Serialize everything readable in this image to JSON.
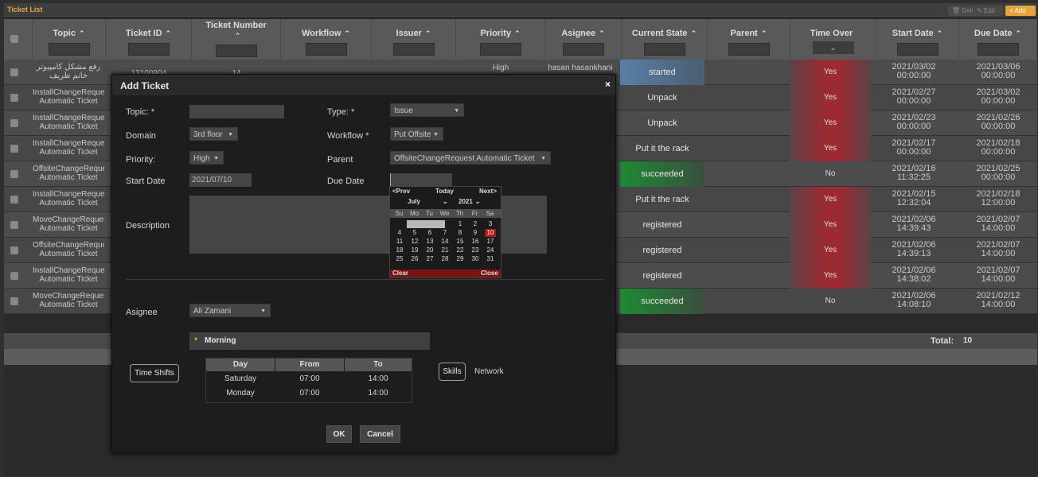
{
  "titlebar": {
    "title": "Ticket List",
    "delete": "🗑 Delete",
    "edit": "✎ Edit",
    "add": "+ Add"
  },
  "columns": [
    {
      "label": "Topic",
      "sort": "⌃"
    },
    {
      "label": "Ticket ID",
      "sort": "⌃"
    },
    {
      "label": "Ticket Number",
      "sort": "⌃"
    },
    {
      "label": "Workflow",
      "sort": "⌃"
    },
    {
      "label": "Issuer",
      "sort": "⌃"
    },
    {
      "label": "Priority",
      "sort": "⌃"
    },
    {
      "label": "Asignee",
      "sort": "⌃"
    },
    {
      "label": "Current State",
      "sort": "⌃"
    },
    {
      "label": "Parent",
      "sort": "⌃"
    },
    {
      "label": "Time Over",
      "sort": ""
    },
    {
      "label": "Start Date",
      "sort": "⌃"
    },
    {
      "label": "Due Date",
      "sort": "⌃"
    }
  ],
  "time_over_filter": "⌄",
  "rows": [
    {
      "topic1": "رفع مشکل کامپیوتر",
      "topic2": "خانم ظریف",
      "id": "13100904",
      "number": "14",
      "priority": "High",
      "asignee": "hasan hasankhani",
      "state": "started",
      "time_over": "Yes",
      "start1": "2021/03/02",
      "start2": "00:00:00",
      "due1": "2021/03/06",
      "due2": "00:00:00"
    },
    {
      "topic1": "InstallChangeReque",
      "topic2": "Automatic Ticket",
      "state": "Unpack",
      "time_over": "Yes",
      "start1": "2021/02/27",
      "start2": "00:00:00",
      "due1": "2021/03/02",
      "due2": "00:00:00"
    },
    {
      "topic1": "InstallChangeReque",
      "topic2": "Automatic Ticket",
      "state": "Unpack",
      "time_over": "Yes",
      "start1": "2021/02/23",
      "start2": "00:00:00",
      "due1": "2021/02/26",
      "due2": "00:00:00"
    },
    {
      "topic1": "InstallChangeReque",
      "topic2": "Automatic Ticket",
      "state": "Put it the rack",
      "time_over": "Yes",
      "start1": "2021/02/17",
      "start2": "00:00:00",
      "due1": "2021/02/18",
      "due2": "00:00:00"
    },
    {
      "topic1": "OffsiteChangeReque",
      "topic2": "Automatic Ticket",
      "state": "succeeded",
      "time_over": "No",
      "start1": "2021/02/16",
      "start2": "11:32:25",
      "due1": "2021/02/25",
      "due2": "00:00:00"
    },
    {
      "topic1": "InstallChangeReque",
      "topic2": "Automatic Ticket",
      "state": "Put it the rack",
      "time_over": "Yes",
      "start1": "2021/02/15",
      "start2": "12:32:04",
      "due1": "2021/02/18",
      "due2": "12:00:00"
    },
    {
      "topic1": "MoveChangeReques",
      "topic2": "Automatic Ticket",
      "state": "registered",
      "time_over": "Yes",
      "start1": "2021/02/06",
      "start2": "14:39:43",
      "due1": "2021/02/07",
      "due2": "14:00:00"
    },
    {
      "topic1": "OffsiteChangeReque",
      "topic2": "Automatic Ticket",
      "state": "registered",
      "time_over": "Yes",
      "start1": "2021/02/06",
      "start2": "14:39:13",
      "due1": "2021/02/07",
      "due2": "14:00:00"
    },
    {
      "topic1": "InstallChangeReque",
      "topic2": "Automatic Ticket",
      "state": "registered",
      "time_over": "Yes",
      "start1": "2021/02/06",
      "start2": "14:38:02",
      "due1": "2021/02/07",
      "due2": "14:00:00"
    },
    {
      "topic1": "MoveChangeReques",
      "topic2": "Automatic Ticket",
      "state": "succeeded",
      "time_over": "No",
      "start1": "2021/02/06",
      "start2": "14:08:10",
      "due1": "2021/02/12",
      "due2": "14:00:00"
    }
  ],
  "total": {
    "label": "Total:",
    "value": "10"
  },
  "modal": {
    "title": "Add Ticket",
    "close": "×",
    "topic_label": "Topic:  *",
    "topic_value": "",
    "type_label": "Type:  *",
    "type_value": "Issue",
    "domain_label": "Domain",
    "domain_value": "3rd floor",
    "workflow_label": "Workflow *",
    "workflow_value": "Put Offsite",
    "priority_label": "Priority:",
    "priority_value": "High",
    "parent_label": "Parent",
    "parent_value": "OffsiteChangeRequest Automatic Ticket",
    "start_label": "Start Date",
    "start_value": "2021/07/10",
    "due_label": "Due Date",
    "due_value": "",
    "description_label": "Description",
    "asignee_label": "Asignee",
    "asignee_value": "Ali Zamani",
    "shift_title": "Morning",
    "shift_arrow": "▾",
    "time_shifts_button": "Time Shifts",
    "skills_button": "Skills",
    "skill_text": "Network",
    "shift_headers": [
      "Day",
      "From",
      "To"
    ],
    "shift_rows": [
      [
        "Saturday",
        "07:00",
        "14:00"
      ],
      [
        "Monday",
        "07:00",
        "14:00"
      ]
    ],
    "ok": "OK",
    "cancel": "Cancel"
  },
  "calendar": {
    "prev": "<Prev",
    "today": "Today",
    "next": "Next>",
    "month": "July",
    "year": "2021",
    "weekdays": [
      "Su",
      "Mo",
      "Tu",
      "We",
      "Th",
      "Fr",
      "Sa"
    ],
    "days": [
      "1",
      "2",
      "3",
      "4",
      "5",
      "6",
      "7",
      "8",
      "9",
      "10",
      "11",
      "12",
      "13",
      "14",
      "15",
      "16",
      "17",
      "18",
      "19",
      "20",
      "21",
      "22",
      "23",
      "24",
      "25",
      "26",
      "27",
      "28",
      "29",
      "30",
      "31"
    ],
    "selected_day": "10",
    "clear": "Clear",
    "close": "Close"
  },
  "colors": {
    "accent": "#e8a33a",
    "started": "#5a7fa8",
    "yes": "#9c2a31",
    "succeeded": "#1d8a35",
    "calendar_selected": "#b01818"
  }
}
